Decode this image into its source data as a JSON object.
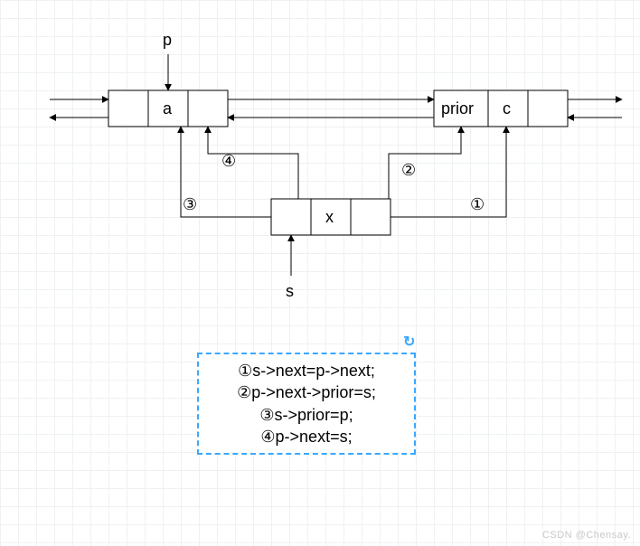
{
  "pointers": {
    "p": "p",
    "s": "s"
  },
  "nodes": {
    "a": "a",
    "prior": "prior",
    "c": "c",
    "x": "x"
  },
  "steps": {
    "s1": "④",
    "s2": "②",
    "s3": "③",
    "s4": "①"
  },
  "code": {
    "line1": "①s->next=p->next;",
    "line2": "②p->next->prior=s;",
    "line3": "③s->prior=p;",
    "line4": "④p->next=s;"
  },
  "watermark": "CSDN @Chensay."
}
